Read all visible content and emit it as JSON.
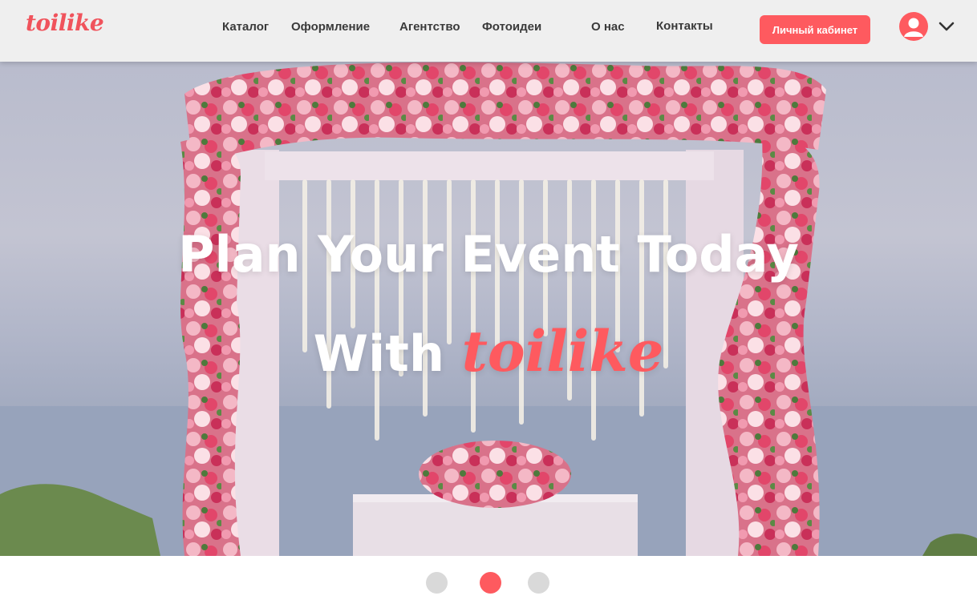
{
  "header": {
    "logo": "toilike",
    "nav": [
      {
        "label": "Каталог"
      },
      {
        "label": "Оформление"
      },
      {
        "label": "Агентство"
      },
      {
        "label": "Фотоидеи"
      },
      {
        "label": "О нас"
      },
      {
        "label": "Контакты"
      }
    ],
    "cabinet_button": "Личный кабинет",
    "avatar_icon": "user-avatar-icon",
    "menu_icon": "chevron-down-icon"
  },
  "hero": {
    "line1": "Plan  Your Event Today",
    "line2_prefix": "With",
    "line2_brand": "toilike",
    "image_subject": "floral-wedding-arch-photo"
  },
  "carousel": {
    "slides": 3,
    "active_index": 1
  },
  "colors": {
    "accent": "#fe5a5f",
    "header_bg": "#efefef",
    "nav_text": "#3a3a3a",
    "dot_inactive": "#d9d9d9"
  }
}
